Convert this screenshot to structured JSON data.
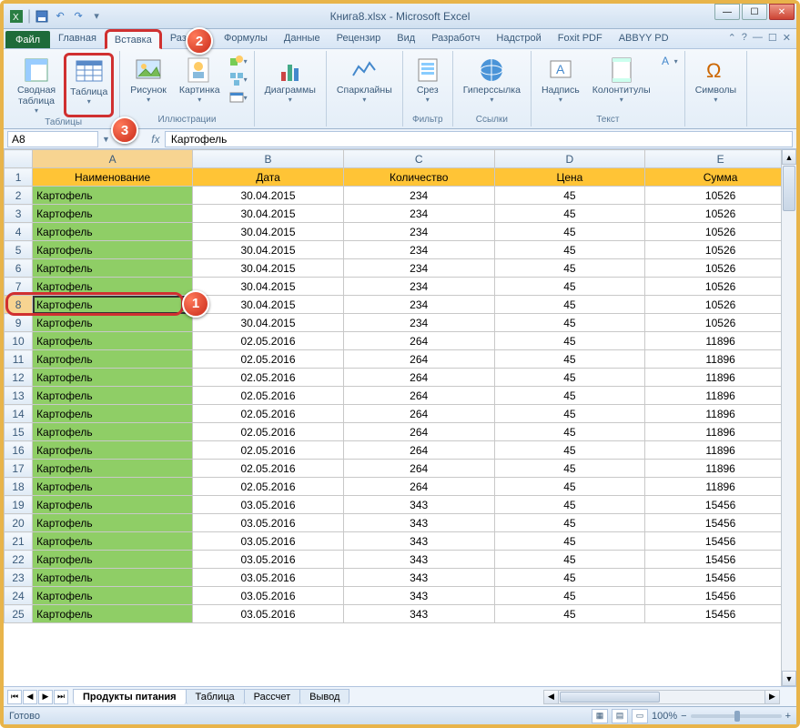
{
  "window": {
    "title": "Книга8.xlsx - Microsoft Excel"
  },
  "qat": {
    "save": "save-icon",
    "undo": "undo-icon",
    "redo": "redo-icon",
    "customize": "customize-icon"
  },
  "tabs": {
    "file": "Файл",
    "list": [
      "Главная",
      "Вставка",
      "Разметк",
      "Формулы",
      "Данные",
      "Рецензир",
      "Вид",
      "Разработч",
      "Надстрой",
      "Foxit PDF",
      "ABBYY PD"
    ],
    "active_index": 1
  },
  "ribbon_help": "?",
  "ribbon": {
    "groups": [
      {
        "label": "Таблицы",
        "items": [
          {
            "name": "pivot-table-button",
            "label": "Сводная\nтаблица",
            "icon": "pivot"
          },
          {
            "name": "table-button",
            "label": "Таблица",
            "icon": "table",
            "highlight": true
          }
        ]
      },
      {
        "label": "Иллюстрации",
        "items": [
          {
            "name": "picture-button",
            "label": "Рисунок",
            "icon": "picture"
          },
          {
            "name": "clipart-button",
            "label": "Картинка",
            "icon": "clipart"
          },
          {
            "name": "shapes-button",
            "label": "",
            "icon": "shapes",
            "small": true
          },
          {
            "name": "smartart-button",
            "label": "",
            "icon": "smartart",
            "small": true
          },
          {
            "name": "screenshot-button",
            "label": "",
            "icon": "screenshot",
            "small": true
          }
        ]
      },
      {
        "label": "",
        "items": [
          {
            "name": "charts-button",
            "label": "Диаграммы",
            "icon": "chart"
          }
        ]
      },
      {
        "label": "",
        "items": [
          {
            "name": "sparklines-button",
            "label": "Спарклайны",
            "icon": "spark"
          }
        ]
      },
      {
        "label": "Фильтр",
        "items": [
          {
            "name": "slicer-button",
            "label": "Срез",
            "icon": "slicer"
          }
        ]
      },
      {
        "label": "Ссылки",
        "items": [
          {
            "name": "hyperlink-button",
            "label": "Гиперссылка",
            "icon": "link"
          }
        ]
      },
      {
        "label": "Текст",
        "items": [
          {
            "name": "textbox-button",
            "label": "Надпись",
            "icon": "textbox"
          },
          {
            "name": "headerfooter-button",
            "label": "Колонтитулы",
            "icon": "headerfooter"
          },
          {
            "name": "text-more-button",
            "label": "",
            "icon": "textmore",
            "small": true
          }
        ]
      },
      {
        "label": "",
        "items": [
          {
            "name": "symbols-button",
            "label": "Символы",
            "icon": "symbol"
          }
        ]
      }
    ]
  },
  "namebox": "A8",
  "formula": "Картофель",
  "columns": [
    "A",
    "B",
    "C",
    "D",
    "E"
  ],
  "headers": [
    "Наименование",
    "Дата",
    "Количество",
    "Цена",
    "Сумма"
  ],
  "rows": [
    {
      "n": 2,
      "a": "Картофель",
      "b": "30.04.2015",
      "c": "234",
      "d": "45",
      "e": "10526"
    },
    {
      "n": 3,
      "a": "Картофель",
      "b": "30.04.2015",
      "c": "234",
      "d": "45",
      "e": "10526"
    },
    {
      "n": 4,
      "a": "Картофель",
      "b": "30.04.2015",
      "c": "234",
      "d": "45",
      "e": "10526"
    },
    {
      "n": 5,
      "a": "Картофель",
      "b": "30.04.2015",
      "c": "234",
      "d": "45",
      "e": "10526"
    },
    {
      "n": 6,
      "a": "Картофель",
      "b": "30.04.2015",
      "c": "234",
      "d": "45",
      "e": "10526"
    },
    {
      "n": 7,
      "a": "Картофель",
      "b": "30.04.2015",
      "c": "234",
      "d": "45",
      "e": "10526"
    },
    {
      "n": 8,
      "a": "Картофель",
      "b": "30.04.2015",
      "c": "234",
      "d": "45",
      "e": "10526",
      "sel": true
    },
    {
      "n": 9,
      "a": "Картофель",
      "b": "30.04.2015",
      "c": "234",
      "d": "45",
      "e": "10526"
    },
    {
      "n": 10,
      "a": "Картофель",
      "b": "02.05.2016",
      "c": "264",
      "d": "45",
      "e": "11896"
    },
    {
      "n": 11,
      "a": "Картофель",
      "b": "02.05.2016",
      "c": "264",
      "d": "45",
      "e": "11896"
    },
    {
      "n": 12,
      "a": "Картофель",
      "b": "02.05.2016",
      "c": "264",
      "d": "45",
      "e": "11896"
    },
    {
      "n": 13,
      "a": "Картофель",
      "b": "02.05.2016",
      "c": "264",
      "d": "45",
      "e": "11896"
    },
    {
      "n": 14,
      "a": "Картофель",
      "b": "02.05.2016",
      "c": "264",
      "d": "45",
      "e": "11896"
    },
    {
      "n": 15,
      "a": "Картофель",
      "b": "02.05.2016",
      "c": "264",
      "d": "45",
      "e": "11896"
    },
    {
      "n": 16,
      "a": "Картофель",
      "b": "02.05.2016",
      "c": "264",
      "d": "45",
      "e": "11896"
    },
    {
      "n": 17,
      "a": "Картофель",
      "b": "02.05.2016",
      "c": "264",
      "d": "45",
      "e": "11896"
    },
    {
      "n": 18,
      "a": "Картофель",
      "b": "02.05.2016",
      "c": "264",
      "d": "45",
      "e": "11896"
    },
    {
      "n": 19,
      "a": "Картофель",
      "b": "03.05.2016",
      "c": "343",
      "d": "45",
      "e": "15456"
    },
    {
      "n": 20,
      "a": "Картофель",
      "b": "03.05.2016",
      "c": "343",
      "d": "45",
      "e": "15456"
    },
    {
      "n": 21,
      "a": "Картофель",
      "b": "03.05.2016",
      "c": "343",
      "d": "45",
      "e": "15456"
    },
    {
      "n": 22,
      "a": "Картофель",
      "b": "03.05.2016",
      "c": "343",
      "d": "45",
      "e": "15456"
    },
    {
      "n": 23,
      "a": "Картофель",
      "b": "03.05.2016",
      "c": "343",
      "d": "45",
      "e": "15456"
    },
    {
      "n": 24,
      "a": "Картофель",
      "b": "03.05.2016",
      "c": "343",
      "d": "45",
      "e": "15456"
    },
    {
      "n": 25,
      "a": "Картофель",
      "b": "03.05.2016",
      "c": "343",
      "d": "45",
      "e": "15456"
    }
  ],
  "sheets": {
    "active": 0,
    "list": [
      "Продукты питания",
      "Таблица",
      "Рассчет",
      "Вывод"
    ]
  },
  "status": {
    "ready": "Готово",
    "zoom": "100%"
  },
  "bubbles": {
    "1": "1",
    "2": "2",
    "3": "3"
  }
}
